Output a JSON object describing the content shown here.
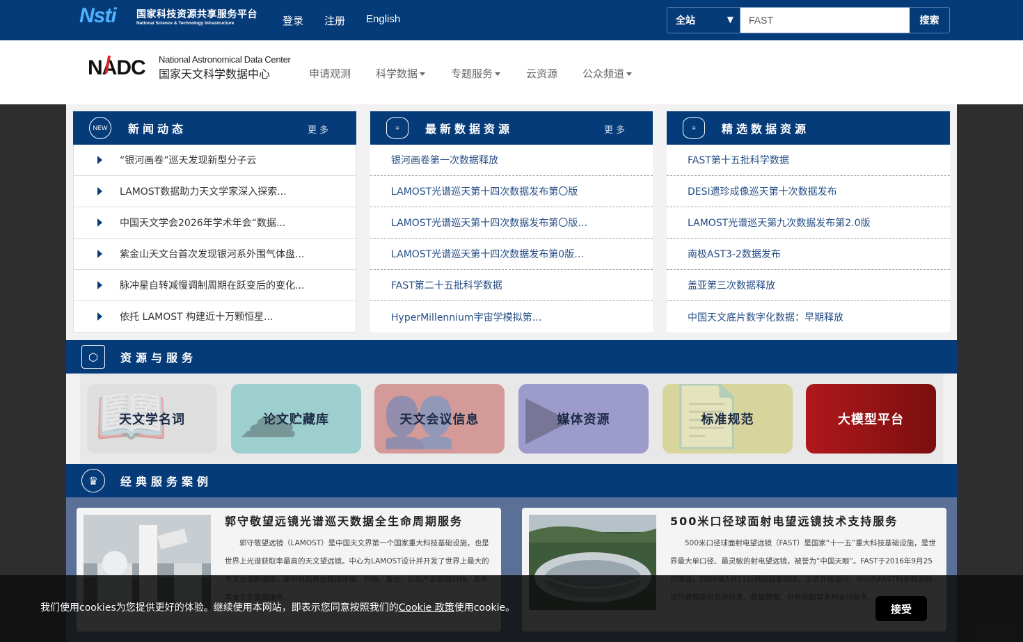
{
  "topbar": {
    "logo_cn": "国家科技资源共享服务平台",
    "logo_en": "National Science & Technology Infrastructure",
    "logo_mark": "Nsti",
    "links": [
      "登录",
      "注册",
      "English"
    ],
    "search_scope": "全站",
    "search_value": "FAST",
    "search_button": "搜索"
  },
  "header": {
    "logo_mark": "NADC",
    "logo_en": "National Astronomical Data Center",
    "logo_cn": "国家天文科学数据中心",
    "nav": [
      {
        "label": "申请观测",
        "dropdown": false
      },
      {
        "label": "科学数据",
        "dropdown": true
      },
      {
        "label": "专题服务",
        "dropdown": true
      },
      {
        "label": "云资源",
        "dropdown": false
      },
      {
        "label": "公众频道",
        "dropdown": true
      }
    ]
  },
  "news": {
    "title": "新闻动态",
    "more": "更多",
    "icon_text": "NEW",
    "items": [
      "“银河画卷”巡天发现新型分子云",
      "LAMOST数据助力天文学家深入探索...",
      "中国天文学会2026年学术年会“数据...",
      "紫金山天文台首次发现银河系外围气体盘...",
      "脉冲星自转减慢调制周期在跃变后的变化...",
      "依托 LAMOST 构建近十万颗恒星..."
    ]
  },
  "latest": {
    "title": "最新数据资源",
    "more": "更多",
    "items": [
      "银河画卷第一次数据释放",
      "LAMOST光谱巡天第十四次数据发布第〇版",
      "LAMOST光谱巡天第十四次数据发布第〇版…",
      "LAMOST光谱巡天第十四次数据发布第0版…",
      "FAST第二十五批科学数据",
      "HyperMillennium宇宙学模拟第…"
    ]
  },
  "featured": {
    "title": "精选数据资源",
    "items": [
      "FAST第十五批科学数据",
      "DESI遗珍成像巡天第十次数据发布",
      "LAMOST光谱巡天第九次数据发布第2.0版",
      "南极AST3-2数据发布",
      "盖亚第三次数据释放",
      "中国天文底片数字化数据：早期释放"
    ]
  },
  "resources": {
    "title": "资源与服务",
    "tiles": [
      {
        "label": "天文学名词",
        "color": "#dedede",
        "icon": "book-icon",
        "glyph": "📖"
      },
      {
        "label": "论文贮藏库",
        "color": "#9ecfcf",
        "icon": "cloud-upload-icon",
        "glyph": "☁"
      },
      {
        "label": "天文会议信息",
        "color": "#d49a98",
        "icon": "people-icon",
        "glyph": "👥"
      },
      {
        "label": "媒体资源",
        "color": "#9d9bcc",
        "icon": "play-icon",
        "glyph": "▶"
      },
      {
        "label": "标准规范",
        "color": "#d8d59c",
        "icon": "document-icon",
        "glyph": "📄"
      },
      {
        "label": "大模型平台",
        "color": "#9a1416",
        "icon": "",
        "glyph": ""
      }
    ]
  },
  "cases": {
    "title": "经典服务案例",
    "items": [
      {
        "title": "郭守敬望远镜光谱巡天数据全生命周期服务",
        "body": "郭守敬望远镜（LAMOST）是中国天文界第一个国家重大科技基础设施，也是世界上光谱获取率最高的天文望远镜。中心为LAMOST设计并开发了世界上最大的天文光谱数据库，提供包括原始数据传输、归档、备份，以及产品数据归档、发布等全生命周期服务。"
      },
      {
        "title": "500米口径球面射电望远镜技术支持服务",
        "body": "500米口径球面射电望远镜（FAST）是国家“十一五”重大科技基础设施，是世界最大单口径、最灵敏的射电望远镜，被誉为“中国天眼”。FAST于2016年9月25日落成，2020年1月11日通过国家验收，正式开放运行。中心为FAST科学观测和运行管理提供系统研发、数据管理、分析挖掘等多种支持服务。"
      }
    ]
  },
  "cookie": {
    "text_before": "我们使用cookies为您提供更好的体验。继续使用本网站，即表示您同意按照我们的",
    "link": "Cookie 政策",
    "text_after": "使用cookie。",
    "accept": "接受"
  }
}
